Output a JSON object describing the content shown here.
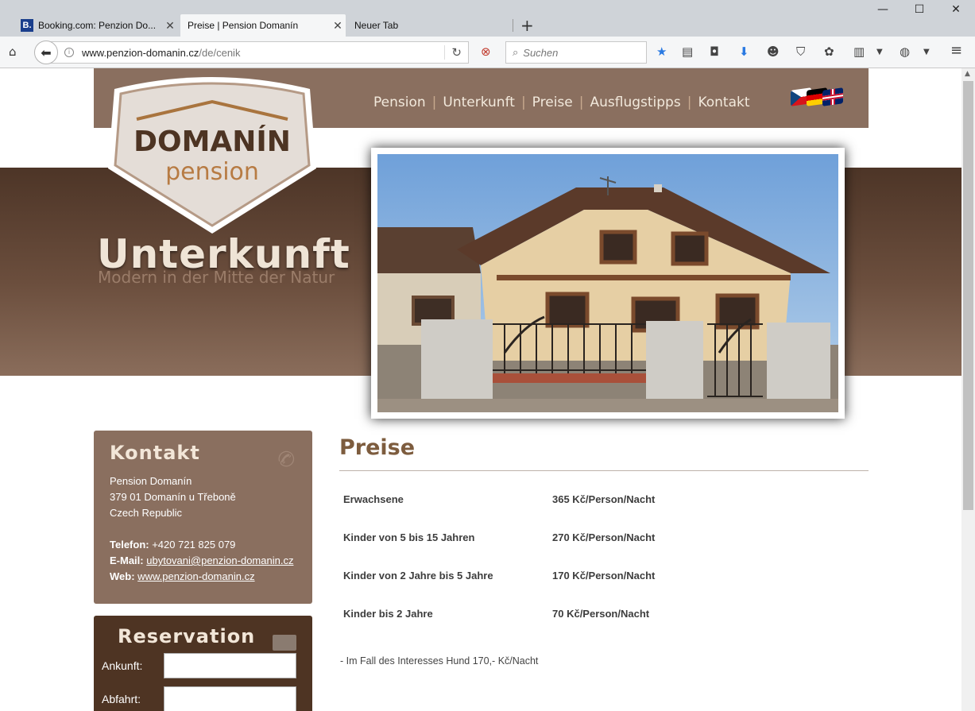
{
  "browser": {
    "tabs": [
      {
        "label": "Booking.com: Penzion Do...",
        "favicon": "B."
      },
      {
        "label": "Preise | Pension Domanín"
      },
      {
        "label": "Neuer Tab"
      }
    ],
    "url_host": "www.penzion-domanin.cz",
    "url_path": "/de/cenik",
    "search_placeholder": "Suchen"
  },
  "site": {
    "logo_line1": "DOMANÍN",
    "logo_line2": "pension",
    "menu": [
      "Pension",
      "Unterkunft",
      "Preise",
      "Ausflugstipps",
      "Kontakt"
    ],
    "hero_title": "Unterkunft",
    "hero_subtitle": "Modern in der Mitte der Natur"
  },
  "kontakt": {
    "title": "Kontakt",
    "name": "Pension Domanín",
    "address": "379 01 Domanín u Třeboně",
    "country": "Czech Republic",
    "phone_label": "Telefon:",
    "phone": "+420 721 825 079",
    "email_label": "E-Mail:",
    "email": "ubytovani@penzion-domanin.cz",
    "web_label": "Web:",
    "web": "www.penzion-domanin.cz"
  },
  "reservation": {
    "title": "Reservation",
    "arrival_label": "Ankunft:",
    "departure_label": "Abfahrt:"
  },
  "prices": {
    "title": "Preise",
    "rows": [
      {
        "label": "Erwachsene",
        "value": "365 Kč/Person/Nacht"
      },
      {
        "label": "Kinder von 5 bis 15 Jahren",
        "value": "270 Kč/Person/Nacht"
      },
      {
        "label": "Kinder von 2 Jahre bis 5 Jahre",
        "value": "170 Kč/Person/Nacht"
      },
      {
        "label": "Kinder bis 2 Jahre",
        "value": "70 Kč/Person/Nacht"
      }
    ],
    "note": "- Im Fall des Interesses Hund 170,- Kč/Nacht"
  },
  "colors": {
    "header": "#8a6f5f",
    "hero": "#5c4232",
    "reservation": "#4e3423",
    "accent_text": "#7d5c3e"
  }
}
